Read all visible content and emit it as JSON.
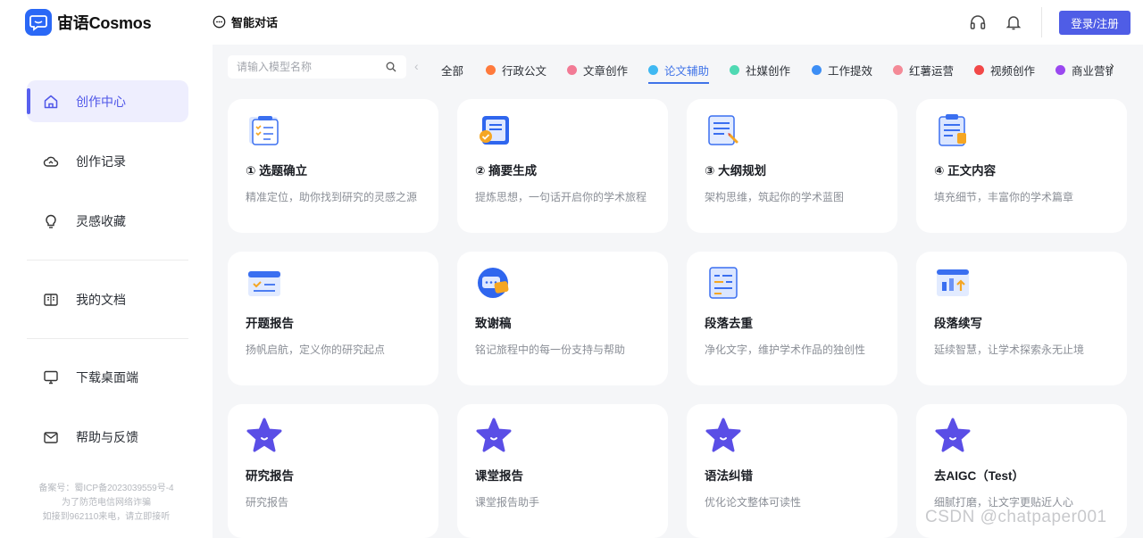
{
  "header": {
    "logo_text": "宙语Cosmos",
    "chat_label": "智能对话",
    "login_label": "登录/注册"
  },
  "sidebar": {
    "items": [
      {
        "label": "创作中心",
        "icon": "home-icon",
        "active": true
      },
      {
        "label": "创作记录",
        "icon": "cloud-icon",
        "active": false
      },
      {
        "label": "灵感收藏",
        "icon": "lightbulb-icon",
        "active": false
      },
      {
        "label": "我的文档",
        "icon": "book-icon",
        "active": false
      },
      {
        "label": "下载桌面端",
        "icon": "monitor-icon",
        "active": false
      },
      {
        "label": "帮助与反馈",
        "icon": "mail-icon",
        "active": false
      }
    ],
    "footer": [
      "备案号：蜀ICP备2023039559号-4",
      "为了防范电信网络诈骗",
      "如接到962110来电，请立即接听"
    ]
  },
  "search": {
    "placeholder": "请输入模型名称"
  },
  "tabs": [
    {
      "label": "全部",
      "color": null,
      "active": false
    },
    {
      "label": "行政公文",
      "color": "#ff7a3c",
      "active": false
    },
    {
      "label": "文章创作",
      "color": "#f27a95",
      "active": false
    },
    {
      "label": "论文辅助",
      "color": "#3fb8f2",
      "active": true
    },
    {
      "label": "社媒创作",
      "color": "#4fd9b3",
      "active": false
    },
    {
      "label": "工作提效",
      "color": "#3d8ef5",
      "active": false
    },
    {
      "label": "红薯运营",
      "color": "#f48a97",
      "active": false
    },
    {
      "label": "视频创作",
      "color": "#f24848",
      "active": false
    },
    {
      "label": "商业营销",
      "color": "#9a48f0",
      "active": false
    }
  ],
  "cards": [
    {
      "title": "① 选题确立",
      "desc": "精准定位，助你找到研究的灵感之源",
      "icon": "checklist-icon"
    },
    {
      "title": "② 摘要生成",
      "desc": "提炼思想，一句话开启你的学术旅程",
      "icon": "verified-doc-icon"
    },
    {
      "title": "③ 大纲规划",
      "desc": "架构思维，筑起你的学术蓝图",
      "icon": "outline-doc-icon"
    },
    {
      "title": "④ 正文内容",
      "desc": "填充细节，丰富你的学术篇章",
      "icon": "clipboard-icon"
    },
    {
      "title": "开题报告",
      "desc": "扬帆启航，定义你的研究起点",
      "icon": "report-icon"
    },
    {
      "title": "致谢稿",
      "desc": "铭记旅程中的每一份支持与帮助",
      "icon": "message-icon"
    },
    {
      "title": "段落去重",
      "desc": "净化文字，维护学术作品的独创性",
      "icon": "dedupe-icon"
    },
    {
      "title": "段落续写",
      "desc": "延续智慧，让学术探索永无止境",
      "icon": "continue-write-icon"
    },
    {
      "title": "研究报告",
      "desc": "研究报告",
      "icon": "star-icon"
    },
    {
      "title": "课堂报告",
      "desc": "课堂报告助手",
      "icon": "star-icon"
    },
    {
      "title": "语法纠错",
      "desc": "优化论文整体可读性",
      "icon": "star-icon"
    },
    {
      "title": "去AIGC（Test）",
      "desc": "细腻打磨，让文字更贴近人心",
      "icon": "star-icon"
    }
  ],
  "watermark": "CSDN @chatpaper001"
}
